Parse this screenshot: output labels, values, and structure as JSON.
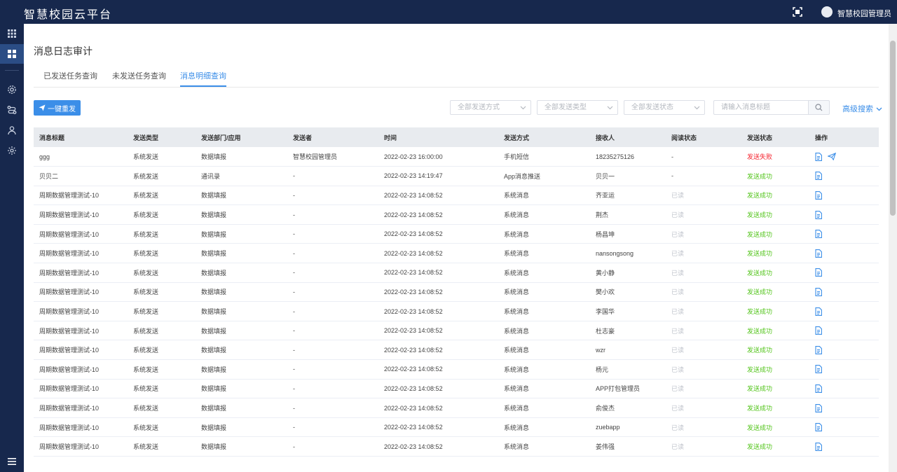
{
  "app": {
    "title": "智慧校园云平台",
    "user": "智慧校园管理员"
  },
  "sidebar": {
    "icons": [
      "grid-icon",
      "dashboard-icon",
      "settings-cog-icon",
      "flow-icon",
      "users-icon",
      "gear-icon",
      "menu-icon"
    ]
  },
  "page": {
    "title": "消息日志审计"
  },
  "tabs": [
    {
      "label": "已发送任务查询",
      "active": false
    },
    {
      "label": "未发送任务查询",
      "active": false
    },
    {
      "label": "消息明细查询",
      "active": true
    }
  ],
  "toolbar": {
    "resend_label": "一键重发",
    "filter_method": "全部发送方式",
    "filter_type": "全部发送类型",
    "filter_status": "全部发送状态",
    "search_placeholder": "请输入消息标题",
    "advanced_search": "高级搜索"
  },
  "table": {
    "columns": [
      "消息标题",
      "发送类型",
      "发送部门/应用",
      "发送者",
      "时间",
      "发送方式",
      "接收人",
      "阅读状态",
      "发送状态",
      "操作"
    ],
    "rows": [
      {
        "title": "ggg",
        "type": "系统发送",
        "dept": "数据填报",
        "sender": "智慧校园管理员",
        "time": "2022-02-23 16:00:00",
        "method": "手机短信",
        "receiver": "18235275126",
        "read": "-",
        "status": "发送失败",
        "status_kind": "fail",
        "resend": true
      },
      {
        "title": "贝贝二",
        "type": "系统发送",
        "dept": "通讯录",
        "sender": "-",
        "time": "2022-02-23 14:19:47",
        "method": "App消息推送",
        "receiver": "贝贝一",
        "read": "-",
        "status": "发送成功",
        "status_kind": "ok",
        "resend": false
      },
      {
        "title": "周期数据管理测试-10",
        "type": "系统发送",
        "dept": "数据填报",
        "sender": "-",
        "time": "2022-02-23 14:08:52",
        "method": "系统消息",
        "receiver": "齐亚运",
        "read": "已读",
        "status": "发送成功",
        "status_kind": "ok",
        "resend": false
      },
      {
        "title": "周期数据管理测试-10",
        "type": "系统发送",
        "dept": "数据填报",
        "sender": "-",
        "time": "2022-02-23 14:08:52",
        "method": "系统消息",
        "receiver": "荆杰",
        "read": "已读",
        "status": "发送成功",
        "status_kind": "ok",
        "resend": false
      },
      {
        "title": "周期数据管理测试-10",
        "type": "系统发送",
        "dept": "数据填报",
        "sender": "-",
        "time": "2022-02-23 14:08:52",
        "method": "系统消息",
        "receiver": "杨昌坤",
        "read": "已读",
        "status": "发送成功",
        "status_kind": "ok",
        "resend": false
      },
      {
        "title": "周期数据管理测试-10",
        "type": "系统发送",
        "dept": "数据填报",
        "sender": "-",
        "time": "2022-02-23 14:08:52",
        "method": "系统消息",
        "receiver": "nansongsong",
        "read": "已读",
        "status": "发送成功",
        "status_kind": "ok",
        "resend": false
      },
      {
        "title": "周期数据管理测试-10",
        "type": "系统发送",
        "dept": "数据填报",
        "sender": "-",
        "time": "2022-02-23 14:08:52",
        "method": "系统消息",
        "receiver": "黄小静",
        "read": "已读",
        "status": "发送成功",
        "status_kind": "ok",
        "resend": false
      },
      {
        "title": "周期数据管理测试-10",
        "type": "系统发送",
        "dept": "数据填报",
        "sender": "-",
        "time": "2022-02-23 14:08:52",
        "method": "系统消息",
        "receiver": "樊小欢",
        "read": "已读",
        "status": "发送成功",
        "status_kind": "ok",
        "resend": false
      },
      {
        "title": "周期数据管理测试-10",
        "type": "系统发送",
        "dept": "数据填报",
        "sender": "-",
        "time": "2022-02-23 14:08:52",
        "method": "系统消息",
        "receiver": "李国华",
        "read": "已读",
        "status": "发送成功",
        "status_kind": "ok",
        "resend": false
      },
      {
        "title": "周期数据管理测试-10",
        "type": "系统发送",
        "dept": "数据填报",
        "sender": "-",
        "time": "2022-02-23 14:08:52",
        "method": "系统消息",
        "receiver": "杜志豪",
        "read": "已读",
        "status": "发送成功",
        "status_kind": "ok",
        "resend": false
      },
      {
        "title": "周期数据管理测试-10",
        "type": "系统发送",
        "dept": "数据填报",
        "sender": "-",
        "time": "2022-02-23 14:08:52",
        "method": "系统消息",
        "receiver": "wzr",
        "read": "已读",
        "status": "发送成功",
        "status_kind": "ok",
        "resend": false
      },
      {
        "title": "周期数据管理测试-10",
        "type": "系统发送",
        "dept": "数据填报",
        "sender": "-",
        "time": "2022-02-23 14:08:52",
        "method": "系统消息",
        "receiver": "杨元",
        "read": "已读",
        "status": "发送成功",
        "status_kind": "ok",
        "resend": false
      },
      {
        "title": "周期数据管理测试-10",
        "type": "系统发送",
        "dept": "数据填报",
        "sender": "-",
        "time": "2022-02-23 14:08:52",
        "method": "系统消息",
        "receiver": "APP打包管理员",
        "read": "已读",
        "status": "发送成功",
        "status_kind": "ok",
        "resend": false
      },
      {
        "title": "周期数据管理测试-10",
        "type": "系统发送",
        "dept": "数据填报",
        "sender": "-",
        "time": "2022-02-23 14:08:52",
        "method": "系统消息",
        "receiver": "俞俊杰",
        "read": "已读",
        "status": "发送成功",
        "status_kind": "ok",
        "resend": false
      },
      {
        "title": "周期数据管理测试-10",
        "type": "系统发送",
        "dept": "数据填报",
        "sender": "-",
        "time": "2022-02-23 14:08:52",
        "method": "系统消息",
        "receiver": "zuebapp",
        "read": "已读",
        "status": "发送成功",
        "status_kind": "ok",
        "resend": false
      },
      {
        "title": "周期数据管理测试-10",
        "type": "系统发送",
        "dept": "数据填报",
        "sender": "-",
        "time": "2022-02-23 14:08:52",
        "method": "系统消息",
        "receiver": "姜伟强",
        "read": "已读",
        "status": "发送成功",
        "status_kind": "ok",
        "resend": false
      }
    ]
  },
  "colors": {
    "accent": "#3b8ee8",
    "topbar": "#17284d",
    "fail": "#f5222d",
    "success": "#52c41a"
  }
}
